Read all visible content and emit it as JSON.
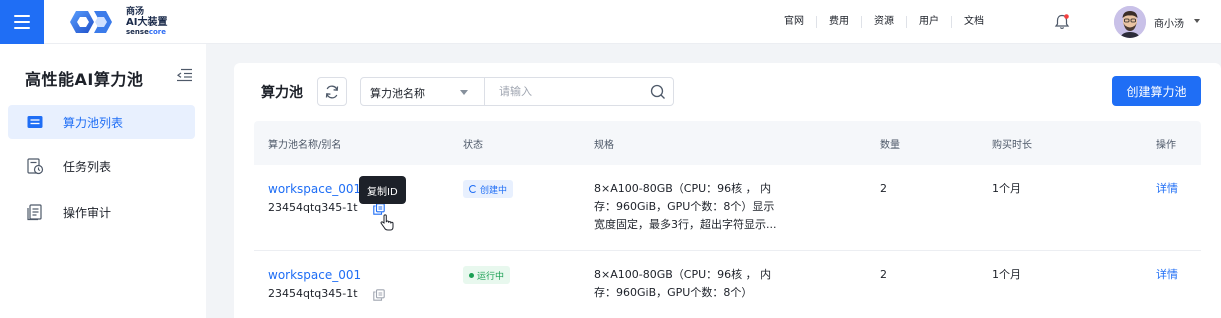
{
  "brand": {
    "name_cn": "商汤",
    "product": "AI大装置",
    "sub_prefix": "sense",
    "sub_suffix": "core"
  },
  "nav": [
    "官网",
    "费用",
    "资源",
    "用户",
    "文档"
  ],
  "user": {
    "name": "商小汤"
  },
  "sidebar": {
    "title": "高性能AI算力池",
    "items": [
      {
        "label": "算力池列表",
        "icon": "list-icon",
        "active": true
      },
      {
        "label": "任务列表",
        "icon": "task-clock-icon",
        "active": false
      },
      {
        "label": "操作审计",
        "icon": "audit-doc-icon",
        "active": false
      }
    ]
  },
  "main": {
    "title": "算力池",
    "search": {
      "field": "算力池名称",
      "placeholder": "请输入"
    },
    "create_button": "创建算力池"
  },
  "table": {
    "headers": [
      "算力池名称/别名",
      "状态",
      "规格",
      "数量",
      "购买时长",
      "操作"
    ],
    "rows": [
      {
        "name": "workspace_001",
        "alias": "23454qtq345-1t",
        "status": "创建中",
        "spec_l1": "8×A100-80GB（CPU：96核 ， 内",
        "spec_l2": "存：960GiB，GPU个数：8个）显示",
        "spec_l3": "宽度固定，最多3行，超出字符显示...",
        "count": "2",
        "duration": "1个月",
        "action": "详情"
      },
      {
        "name": "workspace_001",
        "alias": "23454qtq345-1t",
        "status": "运行中",
        "spec_l1": "8×A100-80GB（CPU：96核 ， 内",
        "spec_l2": "存：960GiB，GPU个数：8个）",
        "count": "2",
        "duration": "1个月",
        "action": "详情"
      }
    ]
  },
  "tooltip": "复制ID",
  "colors": {
    "primary": "#1f6ef5",
    "running": "#1a9f53",
    "background": "#f2f4f7"
  }
}
